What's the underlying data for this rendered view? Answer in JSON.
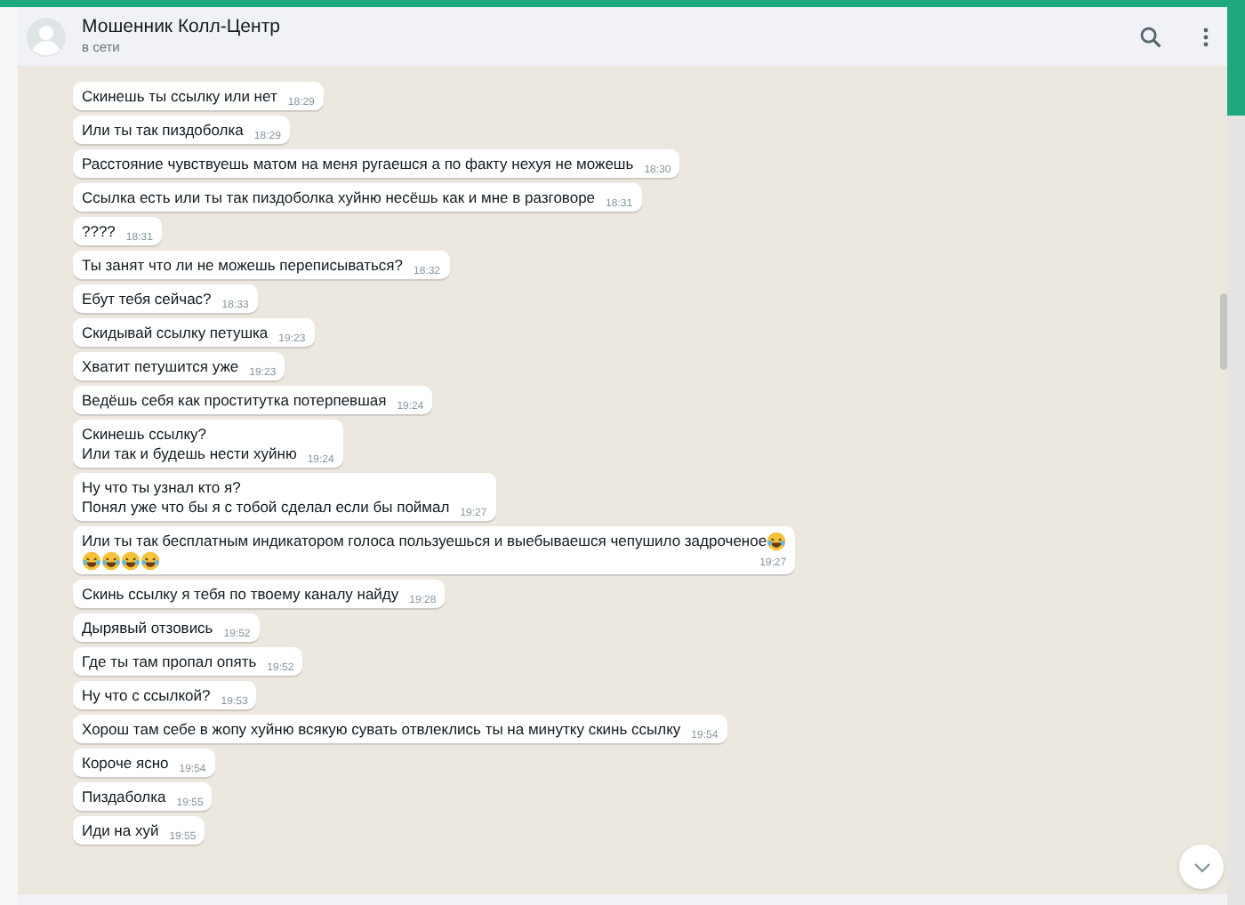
{
  "header": {
    "name": "Мошенник Колл-Центр",
    "status": "в сети"
  },
  "messages": [
    {
      "kind": "text",
      "text": "Скинешь ты ссылку или нет",
      "time": "18:29"
    },
    {
      "kind": "text",
      "text": "Или ты так пиздоболка",
      "time": "18:29"
    },
    {
      "kind": "text",
      "text": "Расстояние чувствуешь матом на меня ругаешся а по факту нехуя не можешь",
      "time": "18:30"
    },
    {
      "kind": "text",
      "text": "Ссылка есть или ты так пиздоболка хуйню несёшь как и мне в разговоре",
      "time": "18:31"
    },
    {
      "kind": "text",
      "text": "????",
      "time": "18:31"
    },
    {
      "kind": "text",
      "text": "Ты занят что ли не можешь переписываться?",
      "time": "18:32"
    },
    {
      "kind": "text",
      "text": "Ебут тебя сейчас?",
      "time": "18:33"
    },
    {
      "kind": "text",
      "text": "Скидывай ссылку петушка",
      "time": "19:23"
    },
    {
      "kind": "text",
      "text": "Хватит петушится уже",
      "time": "19:23"
    },
    {
      "kind": "text",
      "text": "Ведёшь себя как проститутка потерпевшая",
      "time": "19:24"
    },
    {
      "kind": "text",
      "text": "Скинешь ссылку?\nИли так и будешь нести хуйню",
      "time": "19:24"
    },
    {
      "kind": "text",
      "text": "Ну что ты узнал кто я?\nПонял уже что бы я с тобой сделал если бы поймал",
      "time": "19:27"
    },
    {
      "kind": "emoji",
      "text": "Или ты так бесплатным индикатором голоса пользуешься и выебываешся чепушило задроченое",
      "time": "19:27"
    },
    {
      "kind": "text",
      "text": "Скинь ссылку я тебя по твоему каналу найду",
      "time": "19:28"
    },
    {
      "kind": "text",
      "text": "Дырявый отзовись",
      "time": "19:52"
    },
    {
      "kind": "text",
      "text": "Где ты там пропал опять",
      "time": "19:52"
    },
    {
      "kind": "text",
      "text": "Ну что с ссылкой?",
      "time": "19:53"
    },
    {
      "kind": "text",
      "text": "Хорош там себе в жопу хуйню всякую сувать отвлеклись ты на минутку скинь ссылку",
      "time": "19:54"
    },
    {
      "kind": "text",
      "text": "Короче ясно",
      "time": "19:54"
    },
    {
      "kind": "text",
      "text": "Пиздаболка",
      "time": "19:55"
    },
    {
      "kind": "text",
      "text": "Иди на хуй",
      "time": "19:55"
    }
  ]
}
